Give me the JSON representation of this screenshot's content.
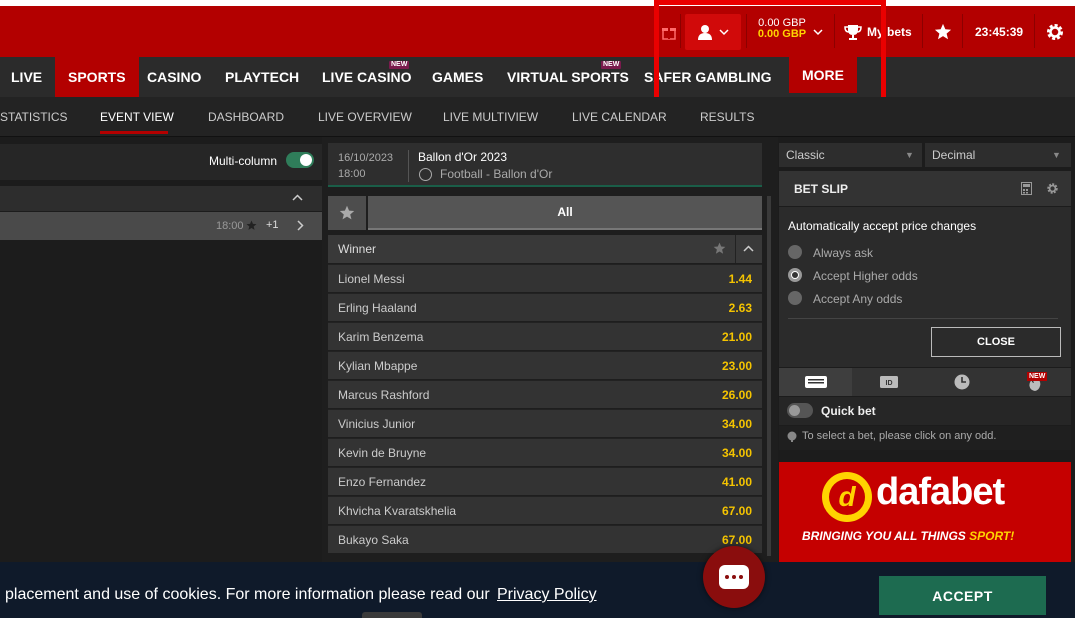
{
  "header": {
    "balance_primary": "0.00 GBP",
    "balance_bonus": "0.00 GBP",
    "my_bets": "My bets",
    "clock": "23:45:39"
  },
  "main_nav": {
    "items": [
      {
        "label": "LIVE"
      },
      {
        "label": "SPORTS"
      },
      {
        "label": "CASINO"
      },
      {
        "label": "PLAYTECH"
      },
      {
        "label": "LIVE CASINO",
        "badge": "NEW"
      },
      {
        "label": "GAMES"
      },
      {
        "label": "VIRTUAL SPORTS",
        "badge": "NEW"
      },
      {
        "label": "SAFER GAMBLING"
      },
      {
        "label": "MORE"
      }
    ]
  },
  "sub_nav": {
    "items": [
      {
        "label": "STATISTICS"
      },
      {
        "label": "EVENT VIEW"
      },
      {
        "label": "DASHBOARD"
      },
      {
        "label": "LIVE OVERVIEW"
      },
      {
        "label": "LIVE MULTIVIEW"
      },
      {
        "label": "LIVE CALENDAR"
      },
      {
        "label": "RESULTS"
      }
    ]
  },
  "left": {
    "multi_column_label": "Multi-column",
    "event_time": "18:00",
    "event_more": "+1"
  },
  "event": {
    "date": "16/10/2023",
    "time": "18:00",
    "title": "Ballon d'Or 2023",
    "subtitle": "Football - Ballon d'Or",
    "tab_all": "All",
    "market_title": "Winner",
    "selections": [
      {
        "name": "Lionel Messi",
        "odds": "1.44"
      },
      {
        "name": "Erling Haaland",
        "odds": "2.63"
      },
      {
        "name": "Karim Benzema",
        "odds": "21.00"
      },
      {
        "name": "Kylian Mbappe",
        "odds": "23.00"
      },
      {
        "name": "Marcus Rashford",
        "odds": "26.00"
      },
      {
        "name": "Vinicius Junior",
        "odds": "34.00"
      },
      {
        "name": "Kevin de Bruyne",
        "odds": "34.00"
      },
      {
        "name": "Enzo Fernandez",
        "odds": "41.00"
      },
      {
        "name": "Khvicha Kvaratskhelia",
        "odds": "67.00"
      },
      {
        "name": "Bukayo Saka",
        "odds": "67.00"
      }
    ]
  },
  "betslip": {
    "view_select": "Classic",
    "odds_format_select": "Decimal",
    "title": "BET SLIP",
    "question": "Automatically accept price changes",
    "options": [
      "Always ask",
      "Accept Higher odds",
      "Accept Any odds"
    ],
    "selected_option": "Accept Higher odds",
    "close_label": "CLOSE",
    "tab_badge": "NEW",
    "quick_bet_label": "Quick bet",
    "info_text": "To select a bet, please click on any odd."
  },
  "banner": {
    "logo_text": "dafabet",
    "slogan_part1": "BRINGING YOU ALL THINGS ",
    "slogan_part2": "SPORT!"
  },
  "cookie": {
    "text": "placement and use of cookies. For more information please read our",
    "link": "Privacy Policy",
    "accept_label": "ACCEPT"
  },
  "colors": {
    "brand_red": "#b30000",
    "odds_yellow": "#f5c400",
    "accept_green": "#1d6b50",
    "highlight_box": "#ea0000"
  }
}
